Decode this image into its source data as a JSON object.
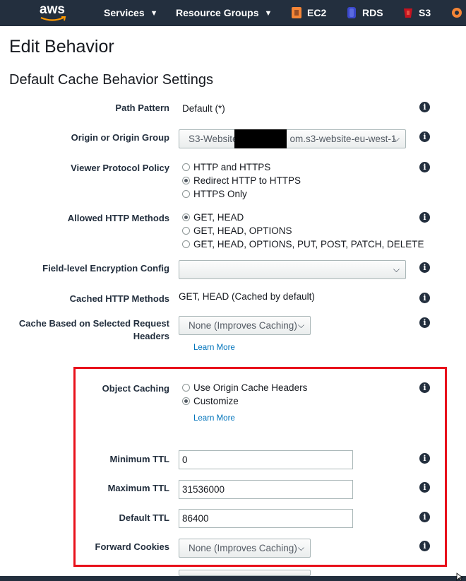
{
  "nav": {
    "logo": "aws",
    "services": "Services",
    "resource_groups": "Resource Groups",
    "ec2": "EC2",
    "rds": "RDS",
    "s3": "S3"
  },
  "page": {
    "title": "Edit Behavior",
    "section_title": "Default Cache Behavior Settings"
  },
  "form": {
    "path_pattern": {
      "label": "Path Pattern",
      "value": "Default (*)"
    },
    "origin": {
      "label": "Origin or Origin Group",
      "value_start": "S3-Website",
      "value_end": "om.s3-website-eu-west-1"
    },
    "viewer_protocol": {
      "label": "Viewer Protocol Policy",
      "options": [
        "HTTP and HTTPS",
        "Redirect HTTP to HTTPS",
        "HTTPS Only"
      ],
      "selected": "Redirect HTTP to HTTPS"
    },
    "allowed_methods": {
      "label": "Allowed HTTP Methods",
      "options": [
        "GET, HEAD",
        "GET, HEAD, OPTIONS",
        "GET, HEAD, OPTIONS, PUT, POST, PATCH, DELETE"
      ],
      "selected": "GET, HEAD"
    },
    "fle_config": {
      "label": "Field-level Encryption Config",
      "value": ""
    },
    "cached_methods": {
      "label": "Cached HTTP Methods",
      "value": "GET, HEAD (Cached by default)"
    },
    "cache_headers": {
      "label_line1": "Cache Based on Selected Request",
      "label_line2": "Headers",
      "value": "None (Improves Caching)",
      "learn_more": "Learn More"
    },
    "object_caching": {
      "label": "Object Caching",
      "options": [
        "Use Origin Cache Headers",
        "Customize"
      ],
      "selected": "Customize",
      "learn_more": "Learn More"
    },
    "min_ttl": {
      "label": "Minimum TTL",
      "value": "0"
    },
    "max_ttl": {
      "label": "Maximum TTL",
      "value": "31536000"
    },
    "default_ttl": {
      "label": "Default TTL",
      "value": "86400"
    },
    "forward_cookies": {
      "label": "Forward Cookies",
      "value": "None (Improves Caching)"
    }
  },
  "icons": {
    "info": "info-icon",
    "caret": "chevron-down-icon"
  },
  "colors": {
    "nav_bg": "#232f3e",
    "link": "#0073bb",
    "highlight": "#e8111b"
  }
}
